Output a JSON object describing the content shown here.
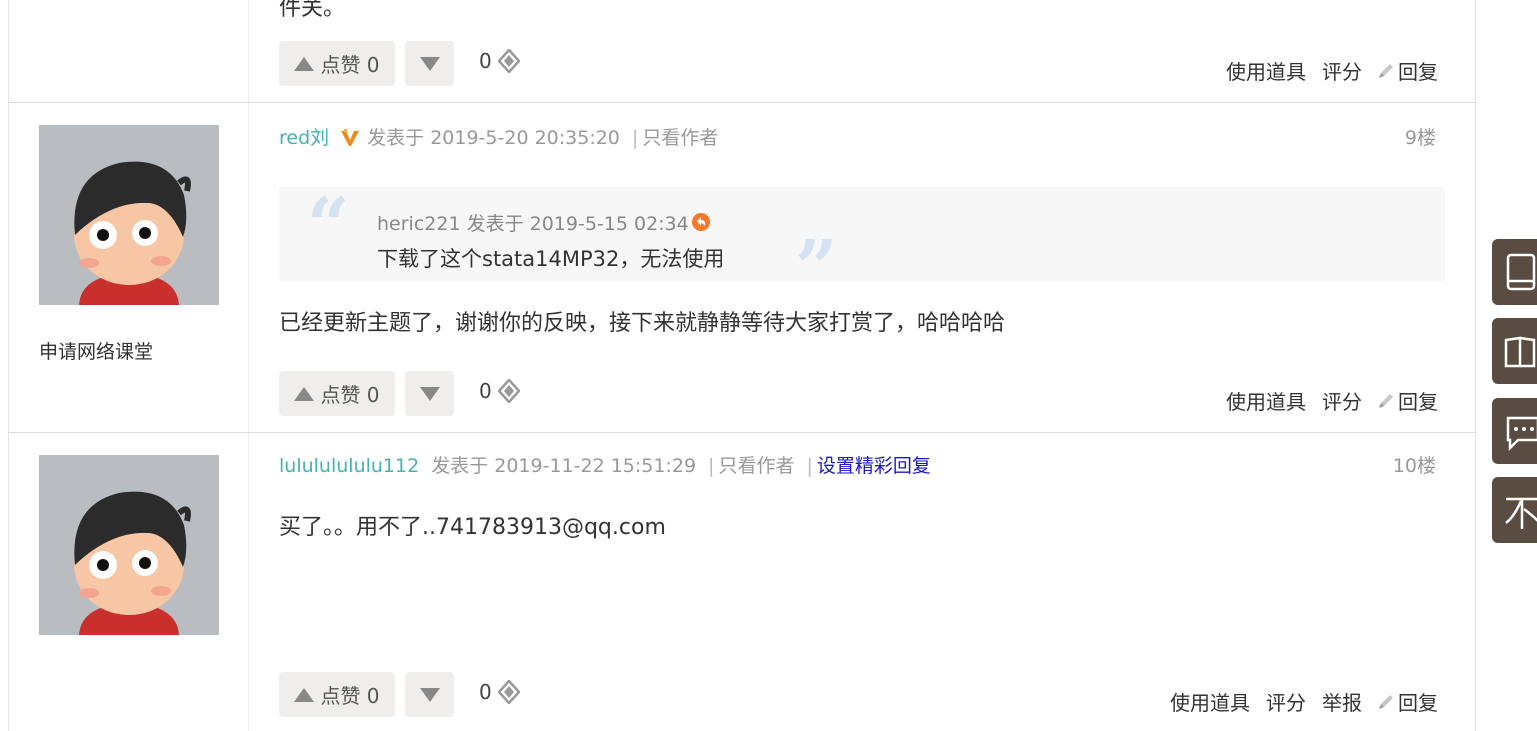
{
  "posts": [
    {
      "top_text": "件关。",
      "like_label": "点赞 0",
      "coin_count": "0",
      "tools": [
        "使用道具",
        "评分"
      ],
      "reply_label": "回复"
    },
    {
      "author": "red刘",
      "posted": "发表于 2019-5-20 20:35:20",
      "only_author": "只看作者",
      "floor": "9楼",
      "side_label": "申请网络课堂",
      "quote": {
        "meta": "heric221 发表于 2019-5-15 02:34",
        "text": "下载了这个stata14MP32，无法使用"
      },
      "content": "已经更新主题了，谢谢你的反映，接下来就静静等待大家打赏了，哈哈哈哈",
      "like_label": "点赞 0",
      "coin_count": "0",
      "tools": [
        "使用道具",
        "评分"
      ],
      "reply_label": "回复"
    },
    {
      "author": "lulululululu112",
      "posted": "发表于 2019-11-22 15:51:29",
      "only_author": "只看作者",
      "set_best": "设置精彩回复",
      "floor": "10楼",
      "content": "买了。。用不了..741783913@qq.com",
      "like_label": "点赞 0",
      "coin_count": "0",
      "tools": [
        "使用道具",
        "评分",
        "举报"
      ],
      "reply_label": "回复"
    }
  ],
  "sidebar_float": [
    "tablet-icon",
    "book-icon",
    "chat-icon",
    "not-icon"
  ],
  "colors": {
    "author": "#42b3b2",
    "blue_link": "#1a1aca",
    "float_bg": "#5a4c40",
    "quote_mark": "#d3e3f1"
  }
}
